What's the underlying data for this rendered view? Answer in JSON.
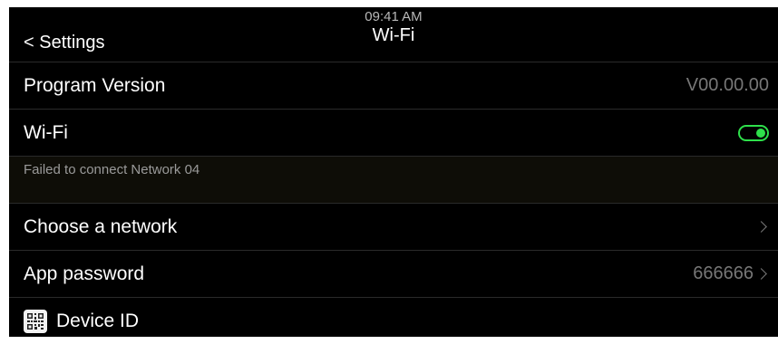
{
  "header": {
    "back_label": "< Settings",
    "time": "09:41 AM",
    "title": "Wi-Fi"
  },
  "rows": {
    "program_version": {
      "label": "Program Version",
      "value": "V00.00.00"
    },
    "wifi": {
      "label": "Wi-Fi",
      "enabled": true
    },
    "status": {
      "message": "Failed to connect Network 04"
    },
    "choose_network": {
      "label": "Choose a network"
    },
    "app_password": {
      "label": "App password",
      "value": "666666"
    },
    "device_id": {
      "label": "Device ID",
      "icon": "qr-code-icon"
    }
  },
  "colors": {
    "background": "#000000",
    "toggle_on": "#2ee04b",
    "secondary_text": "#777777",
    "divider": "#2a2a2a"
  }
}
